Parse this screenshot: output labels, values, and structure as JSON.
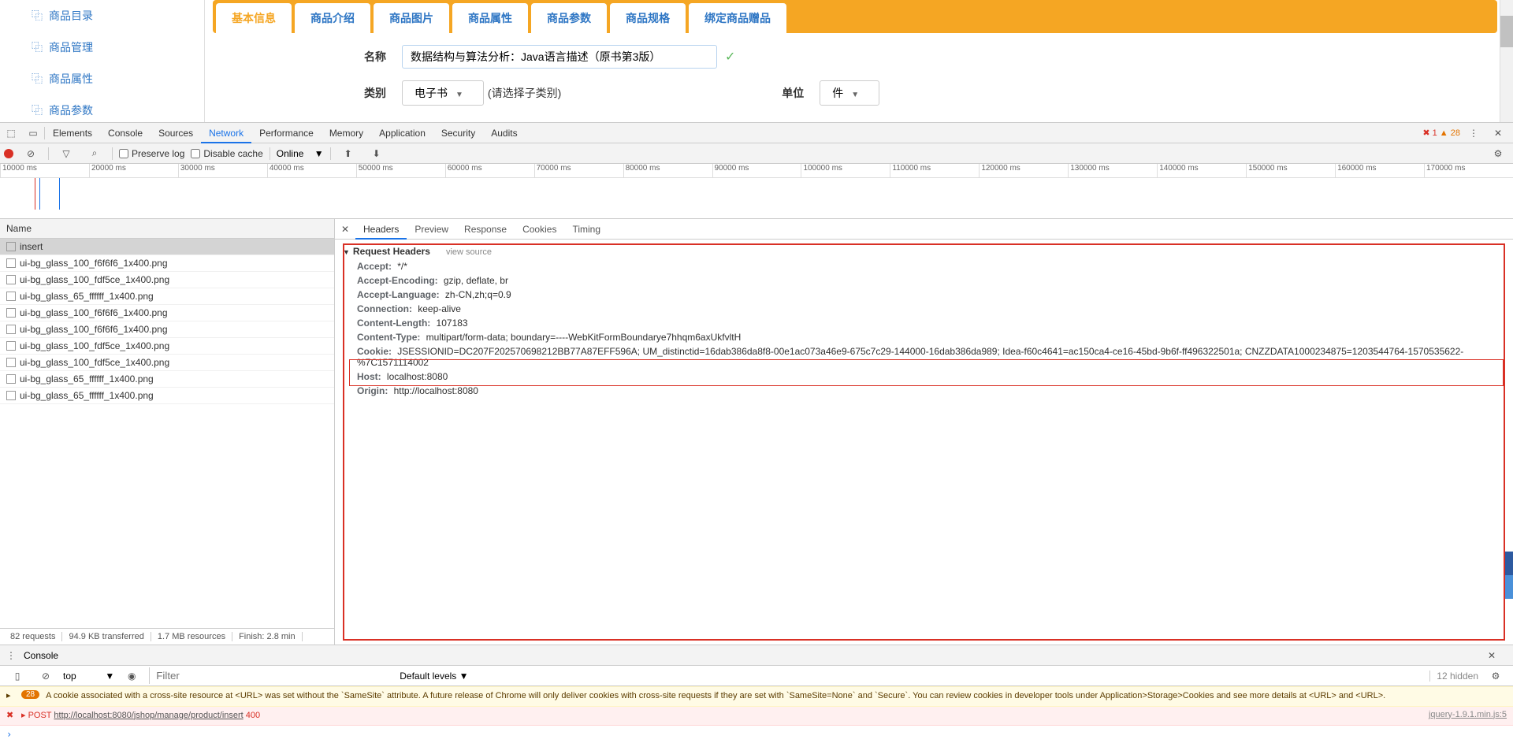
{
  "sidebar": {
    "items": [
      {
        "label": "商品目录"
      },
      {
        "label": "商品管理"
      },
      {
        "label": "商品属性"
      },
      {
        "label": "商品参数"
      }
    ]
  },
  "tabs": [
    {
      "label": "基本信息",
      "active": true
    },
    {
      "label": "商品介绍"
    },
    {
      "label": "商品图片"
    },
    {
      "label": "商品属性"
    },
    {
      "label": "商品参数"
    },
    {
      "label": "商品规格"
    },
    {
      "label": "绑定商品赠品"
    }
  ],
  "form": {
    "name_label": "名称",
    "name_value": "数据结构与算法分析：Java语言描述（原书第3版）",
    "category_label": "类别",
    "category_value": "电子书",
    "category_hint": "(请选择子类别)",
    "unit_label": "单位",
    "unit_value": "件"
  },
  "devtools": {
    "tabs": [
      "Elements",
      "Console",
      "Sources",
      "Network",
      "Performance",
      "Memory",
      "Application",
      "Security",
      "Audits"
    ],
    "active_tab": "Network",
    "errors": "1",
    "warnings": "28",
    "preserve_log": "Preserve log",
    "disable_cache": "Disable cache",
    "online": "Online",
    "timeline_ticks": [
      "10000 ms",
      "20000 ms",
      "30000 ms",
      "40000 ms",
      "50000 ms",
      "60000 ms",
      "70000 ms",
      "80000 ms",
      "90000 ms",
      "100000 ms",
      "110000 ms",
      "120000 ms",
      "130000 ms",
      "140000 ms",
      "150000 ms",
      "160000 ms",
      "170000 ms"
    ],
    "name_header": "Name",
    "requests": [
      {
        "name": "insert",
        "selected": true
      },
      {
        "name": "ui-bg_glass_100_f6f6f6_1x400.png"
      },
      {
        "name": "ui-bg_glass_100_fdf5ce_1x400.png"
      },
      {
        "name": "ui-bg_glass_65_ffffff_1x400.png"
      },
      {
        "name": "ui-bg_glass_100_f6f6f6_1x400.png"
      },
      {
        "name": "ui-bg_glass_100_f6f6f6_1x400.png"
      },
      {
        "name": "ui-bg_glass_100_fdf5ce_1x400.png"
      },
      {
        "name": "ui-bg_glass_100_fdf5ce_1x400.png"
      },
      {
        "name": "ui-bg_glass_65_ffffff_1x400.png"
      },
      {
        "name": "ui-bg_glass_65_ffffff_1x400.png"
      }
    ],
    "status": {
      "requests": "82 requests",
      "transferred": "94.9 KB transferred",
      "resources": "1.7 MB resources",
      "finish": "Finish: 2.8 min"
    },
    "detail_tabs": [
      "Headers",
      "Preview",
      "Response",
      "Cookies",
      "Timing"
    ],
    "detail_active": "Headers",
    "section_title": "Request Headers",
    "view_source": "view source",
    "headers": [
      {
        "k": "Accept:",
        "v": "*/*"
      },
      {
        "k": "Accept-Encoding:",
        "v": "gzip, deflate, br"
      },
      {
        "k": "Accept-Language:",
        "v": "zh-CN,zh;q=0.9"
      },
      {
        "k": "Connection:",
        "v": "keep-alive"
      },
      {
        "k": "Content-Length:",
        "v": "107183"
      },
      {
        "k": "Content-Type:",
        "v": "multipart/form-data; boundary=----WebKitFormBoundarye7hhqm6axUkfvltH"
      },
      {
        "k": "Cookie:",
        "v": "JSESSIONID=DC207F202570698212BB77A87EFF596A; UM_distinctid=16dab386da8f8-00e1ac073a46e9-675c7c29-144000-16dab386da989; Idea-f60c4641=ac150ca4-ce16-45bd-9b6f-ff496322501a; CNZZDATA1000234875=1203544764-1570535622-%7C1571114002"
      },
      {
        "k": "Host:",
        "v": "localhost:8080"
      },
      {
        "k": "Origin:",
        "v": "http://localhost:8080"
      }
    ]
  },
  "console": {
    "title": "Console",
    "top": "top",
    "filter_placeholder": "Filter",
    "levels": "Default levels",
    "hidden": "12 hidden",
    "warn_badge": "28",
    "warn_text": "A cookie associated with a cross-site resource at <URL> was set without the `SameSite` attribute. A future release of Chrome will only deliver cookies with cross-site requests if they are set with `SameSite=None` and `Secure`. You can review cookies in developer tools under Application>Storage>Cookies and see more details at <URL> and <URL>.",
    "err_method": "POST",
    "err_url": "http://localhost:8080/jshop/manage/product/insert",
    "err_code": "400",
    "err_link": "jquery-1.9.1.min.js:5"
  }
}
